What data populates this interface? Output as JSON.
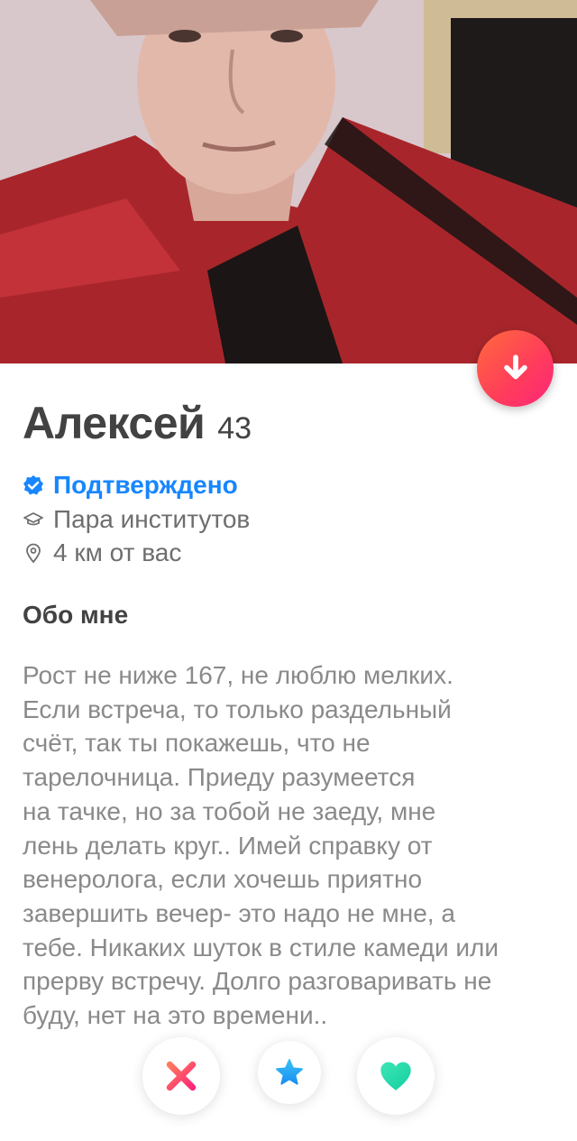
{
  "profile": {
    "name": "Алексей",
    "age": "43",
    "verified_label": "Подтверждено",
    "school": "Пара институтов",
    "distance": "4 км от вас"
  },
  "about": {
    "title": "Обо мне",
    "bio": "Рост не ниже 167, не люблю мелких.\nЕсли встреча, то только раздельный\nсчёт, так ты покажешь, что не\nтарелочница. Приеду разумеется\nна тачке, но за тобой не заеду, мне\nлень делать круг.. Имей справку от\nвенеролога, если хочешь приятно\nзавершить вечер- это надо не мне, а\nтебе. Никаких шуток в стиле камеди или\nпрерву встречу. Долго разговаривать не\nбуду, нет на это времени.."
  },
  "icons": {
    "collapse": "arrow-down-icon",
    "verified": "verified-check-icon",
    "school": "graduation-cap-icon",
    "distance": "location-pin-icon",
    "nope": "x-icon",
    "super_like": "star-icon",
    "like": "heart-icon"
  },
  "colors": {
    "brand_gradient_start": "#ff6a3d",
    "brand_gradient_end": "#fd267a",
    "verified": "#1786ff",
    "nope": "#fd4e6c",
    "super_like": "#2db1f3",
    "like": "#1ed8a8"
  }
}
